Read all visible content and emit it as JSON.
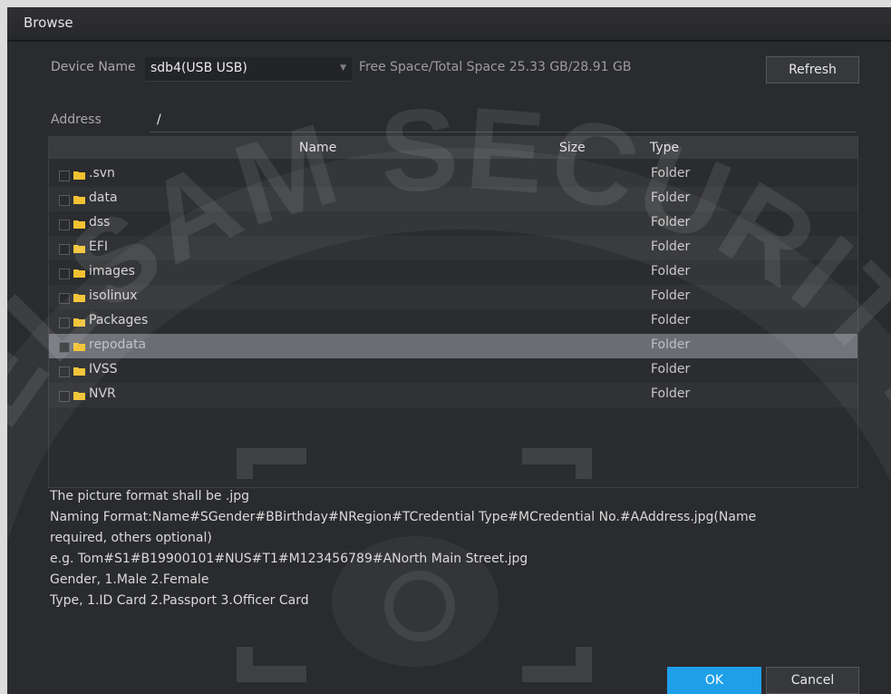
{
  "dialog": {
    "title": "Browse"
  },
  "device": {
    "label": "Device Name",
    "selected": "sdb4(USB USB)",
    "space_text": "Free Space/Total Space 25.33 GB/28.91 GB",
    "refresh_label": "Refresh"
  },
  "address": {
    "label": "Address",
    "value": "/"
  },
  "table": {
    "columns": {
      "name": "Name",
      "size": "Size",
      "type": "Type"
    },
    "rows": [
      {
        "name": ".svn",
        "size": "",
        "type": "Folder"
      },
      {
        "name": "data",
        "size": "",
        "type": "Folder"
      },
      {
        "name": "dss",
        "size": "",
        "type": "Folder"
      },
      {
        "name": "EFI",
        "size": "",
        "type": "Folder"
      },
      {
        "name": "images",
        "size": "",
        "type": "Folder"
      },
      {
        "name": "isolinux",
        "size": "",
        "type": "Folder"
      },
      {
        "name": "Packages",
        "size": "",
        "type": "Folder"
      },
      {
        "name": "repodata",
        "size": "",
        "type": "Folder",
        "selected": true
      },
      {
        "name": "IVSS",
        "size": "",
        "type": "Folder"
      },
      {
        "name": "NVR",
        "size": "",
        "type": "Folder"
      }
    ]
  },
  "notes": [
    "The picture format shall be .jpg",
    " Naming Format:Name#SGender#BBirthday#NRegion#TCredential Type#MCredential No.#AAddress.jpg(Name",
    "required, others optional)",
    "e.g. Tom#S1#B19900101#NUS#T1#M123456789#ANorth Main Street.jpg",
    "Gender, 1.Male 2.Female",
    "Type, 1.ID Card 2.Passport 3.Officer Card"
  ],
  "buttons": {
    "ok": "OK",
    "cancel": "Cancel"
  },
  "watermark": {
    "text": "ELSAM SECURITY"
  },
  "colors": {
    "accent": "#1e9fe8",
    "folder": "#f2c232",
    "selected_row": "#6b6d72"
  }
}
